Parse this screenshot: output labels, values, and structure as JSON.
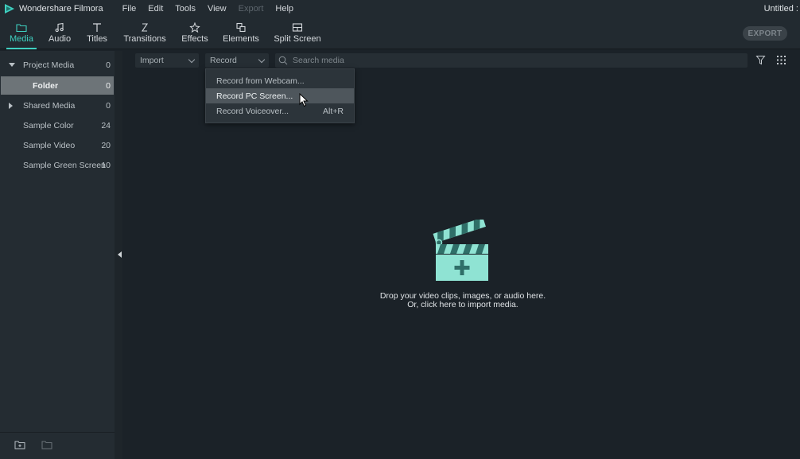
{
  "app": {
    "name": "Wondershare Filmora",
    "document_title": "Untitled :"
  },
  "menu": [
    "File",
    "Edit",
    "Tools",
    "View",
    "Export",
    "Help"
  ],
  "menu_disabled": [
    "Export"
  ],
  "tabs": [
    {
      "label": "Media",
      "icon": "folder-icon",
      "active": true
    },
    {
      "label": "Audio",
      "icon": "music-note-icon",
      "active": false
    },
    {
      "label": "Titles",
      "icon": "text-icon",
      "active": false
    },
    {
      "label": "Transitions",
      "icon": "transition-icon",
      "active": false
    },
    {
      "label": "Effects",
      "icon": "effects-icon",
      "active": false
    },
    {
      "label": "Elements",
      "icon": "elements-icon",
      "active": false
    },
    {
      "label": "Split Screen",
      "icon": "split-screen-icon",
      "active": false
    }
  ],
  "export_button": "EXPORT",
  "sidebar": {
    "items": [
      {
        "label": "Project Media",
        "count": "0",
        "expand": "expanded"
      },
      {
        "label": "Folder",
        "count": "0",
        "selected": true
      },
      {
        "label": "Shared Media",
        "count": "0",
        "expand": "collapsed"
      },
      {
        "label": "Sample Color",
        "count": "24"
      },
      {
        "label": "Sample Video",
        "count": "20"
      },
      {
        "label": "Sample Green Screen",
        "count": "10"
      }
    ]
  },
  "media_toolbar": {
    "import_label": "Import",
    "record_label": "Record",
    "search_placeholder": "Search media"
  },
  "record_menu": {
    "items": [
      {
        "label": "Record from Webcam...",
        "shortcut": ""
      },
      {
        "label": "Record PC Screen...",
        "shortcut": "",
        "highlighted": true
      },
      {
        "label": "Record Voiceover...",
        "shortcut": "Alt+R"
      }
    ]
  },
  "empty_state": {
    "line1": "Drop your video clips, images, or audio here.",
    "line2": "Or, click here to import media."
  },
  "colors": {
    "accent": "#3fd0c0",
    "background": "#1b2228",
    "panel": "#242c32",
    "selected_row": "#6d7478"
  }
}
